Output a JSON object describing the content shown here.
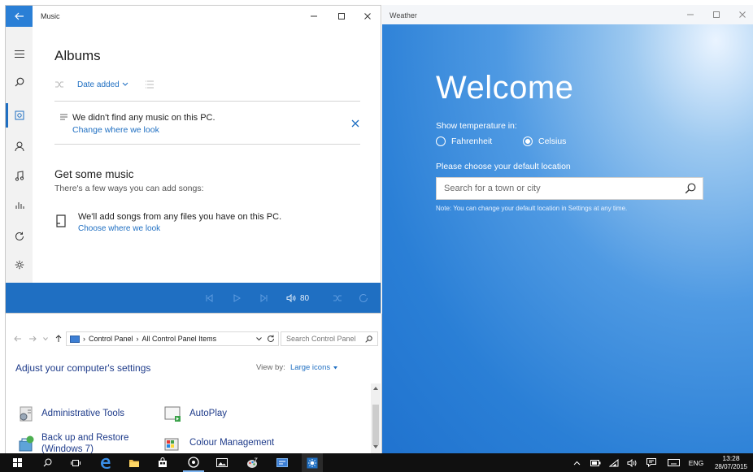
{
  "music": {
    "window_title": "Music",
    "heading": "Albums",
    "sort_label": "Date added",
    "notice_text": "We didn't find any music on this PC.",
    "notice_link": "Change where we look",
    "get_music_heading": "Get some music",
    "get_music_sub": "There's a few ways you can add songs:",
    "add_songs_text": "We'll add songs from any files you have on this PC.",
    "add_songs_link": "Choose where we look",
    "volume": "80"
  },
  "control_panel": {
    "breadcrumb": [
      "Control Panel",
      "All Control Panel Items"
    ],
    "search_placeholder": "Search Control Panel",
    "heading": "Adjust your computer's settings",
    "view_by_label": "View by:",
    "view_by_value": "Large icons",
    "items": [
      {
        "label": "Administrative Tools"
      },
      {
        "label": "AutoPlay"
      },
      {
        "label": "Back up and Restore (Windows 7)"
      },
      {
        "label": "Colour Management"
      }
    ]
  },
  "weather": {
    "window_title": "Weather",
    "welcome": "Welcome",
    "temp_label": "Show temperature in:",
    "units": [
      {
        "label": "Fahrenheit",
        "selected": false
      },
      {
        "label": "Celsius",
        "selected": true
      }
    ],
    "location_label": "Please choose your default location",
    "search_placeholder": "Search for a town or city",
    "note": "Note: You can change your default location in Settings at any time."
  },
  "taskbar": {
    "language": "ENG",
    "time": "13:28",
    "date": "28/07/2015"
  },
  "colors": {
    "accent": "#1f6fc2",
    "taskbar": "#101010",
    "weather_bg": "#2a7fd6"
  }
}
